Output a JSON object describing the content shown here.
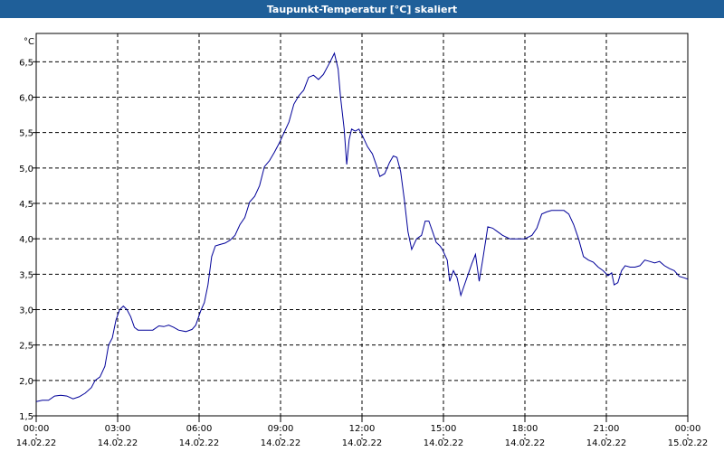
{
  "window": {
    "title": "Taupunkt-Temperatur [°C] skaliert"
  },
  "colors": {
    "title_bar": "#1f5f99",
    "line": "#000099",
    "grid": "#000000"
  },
  "chart_data": {
    "type": "line",
    "title": "Taupunkt-Temperatur [°C] skaliert",
    "unit_label": "°C",
    "ylim": [
      1.5,
      6.9
    ],
    "xlim": [
      0,
      24
    ],
    "grid": true,
    "yticks": [
      "1,5",
      "2,0",
      "2,5",
      "3,0",
      "3,5",
      "4,0",
      "4,5",
      "5,0",
      "5,5",
      "6,0",
      "6,5"
    ],
    "xticks": [
      {
        "time": "00:00",
        "date": "14.02.22"
      },
      {
        "time": "03:00",
        "date": "14.02.22"
      },
      {
        "time": "06:00",
        "date": "14.02.22"
      },
      {
        "time": "09:00",
        "date": "14.02.22"
      },
      {
        "time": "12:00",
        "date": "14.02.22"
      },
      {
        "time": "15:00",
        "date": "14.02.22"
      },
      {
        "time": "18:00",
        "date": "14.02.22"
      },
      {
        "time": "21:00",
        "date": "14.02.22"
      },
      {
        "time": "00:00",
        "date": "15.02.22"
      }
    ],
    "series": [
      {
        "points": [
          [
            0.0,
            1.7
          ],
          [
            0.25,
            1.72
          ],
          [
            0.5,
            1.72
          ],
          [
            0.75,
            1.78
          ],
          [
            1.0,
            1.79
          ],
          [
            1.25,
            1.78
          ],
          [
            1.5,
            1.74
          ],
          [
            1.75,
            1.77
          ],
          [
            2.0,
            1.82
          ],
          [
            2.25,
            1.9
          ],
          [
            2.4,
            2.0
          ],
          [
            2.6,
            2.05
          ],
          [
            2.8,
            2.2
          ],
          [
            2.95,
            2.5
          ],
          [
            3.1,
            2.6
          ],
          [
            3.25,
            2.85
          ],
          [
            3.4,
            3.0
          ],
          [
            3.55,
            3.05
          ],
          [
            3.7,
            3.0
          ],
          [
            3.85,
            2.9
          ],
          [
            4.0,
            2.75
          ],
          [
            4.15,
            2.71
          ],
          [
            4.5,
            2.71
          ],
          [
            4.75,
            2.71
          ],
          [
            5.0,
            2.77
          ],
          [
            5.2,
            2.76
          ],
          [
            5.4,
            2.78
          ],
          [
            5.6,
            2.75
          ],
          [
            5.8,
            2.71
          ],
          [
            6.1,
            2.69
          ],
          [
            6.35,
            2.72
          ],
          [
            6.5,
            2.78
          ],
          [
            6.7,
            2.98
          ],
          [
            6.85,
            3.1
          ],
          [
            7.0,
            3.35
          ],
          [
            7.15,
            3.75
          ],
          [
            7.3,
            3.9
          ],
          [
            7.5,
            3.92
          ],
          [
            7.7,
            3.94
          ],
          [
            7.9,
            3.98
          ],
          [
            8.1,
            4.05
          ],
          [
            8.3,
            4.2
          ],
          [
            8.5,
            4.3
          ],
          [
            8.7,
            4.52
          ],
          [
            8.9,
            4.6
          ],
          [
            9.1,
            4.75
          ],
          [
            9.3,
            5.02
          ],
          [
            9.5,
            5.1
          ],
          [
            9.7,
            5.22
          ],
          [
            9.9,
            5.35
          ],
          [
            10.1,
            5.5
          ],
          [
            10.3,
            5.65
          ],
          [
            10.5,
            5.9
          ],
          [
            10.7,
            6.02
          ],
          [
            10.9,
            6.1
          ],
          [
            11.1,
            6.28
          ],
          [
            11.3,
            6.31
          ],
          [
            11.5,
            6.25
          ],
          [
            11.7,
            6.32
          ],
          [
            11.9,
            6.45
          ],
          [
            12.05,
            6.55
          ],
          [
            12.15,
            6.62
          ],
          [
            12.3,
            6.4
          ],
          [
            12.4,
            6.0
          ],
          [
            12.55,
            5.55
          ],
          [
            12.65,
            5.05
          ],
          [
            12.75,
            5.4
          ],
          [
            12.85,
            5.55
          ],
          [
            13.0,
            5.52
          ],
          [
            13.15,
            5.55
          ],
          [
            13.3,
            5.45
          ],
          [
            13.5,
            5.3
          ],
          [
            13.7,
            5.2
          ],
          [
            13.85,
            5.05
          ],
          [
            14.0,
            4.88
          ],
          [
            14.2,
            4.92
          ],
          [
            14.4,
            5.08
          ],
          [
            14.55,
            5.17
          ],
          [
            14.7,
            5.15
          ],
          [
            14.85,
            4.95
          ],
          [
            15.0,
            4.55
          ],
          [
            15.15,
            4.1
          ],
          [
            15.3,
            3.85
          ],
          [
            15.5,
            4.0
          ],
          [
            15.7,
            4.05
          ],
          [
            15.85,
            4.25
          ],
          [
            16.0,
            4.25
          ],
          [
            16.15,
            4.1
          ],
          [
            16.3,
            3.95
          ],
          [
            16.45,
            3.9
          ],
          [
            16.55,
            3.85
          ],
          [
            16.75,
            3.7
          ],
          [
            16.85,
            3.4
          ],
          [
            17.0,
            3.55
          ],
          [
            17.15,
            3.45
          ],
          [
            17.3,
            3.2
          ],
          [
            17.45,
            3.35
          ],
          [
            17.6,
            3.5
          ],
          [
            17.75,
            3.65
          ],
          [
            17.9,
            3.78
          ],
          [
            18.05,
            3.4
          ],
          [
            18.2,
            3.72
          ],
          [
            18.4,
            4.17
          ],
          [
            18.6,
            4.15
          ],
          [
            18.8,
            4.1
          ],
          [
            19.0,
            4.05
          ],
          [
            19.3,
            4.0
          ],
          [
            19.6,
            4.0
          ],
          [
            19.9,
            4.0
          ],
          [
            20.2,
            4.05
          ],
          [
            20.4,
            4.15
          ],
          [
            20.6,
            4.35
          ],
          [
            20.8,
            4.38
          ],
          [
            21.0,
            4.4
          ],
          [
            21.3,
            4.4
          ],
          [
            21.5,
            4.4
          ],
          [
            21.7,
            4.35
          ],
          [
            21.9,
            4.2
          ],
          [
            22.1,
            4.0
          ],
          [
            22.3,
            3.75
          ],
          [
            22.5,
            3.7
          ],
          [
            22.7,
            3.67
          ],
          [
            22.9,
            3.6
          ],
          [
            23.1,
            3.55
          ],
          [
            23.3,
            3.48
          ],
          [
            23.45,
            3.52
          ],
          [
            23.55,
            3.35
          ],
          [
            23.7,
            3.38
          ],
          [
            23.85,
            3.55
          ],
          [
            24.0,
            3.62
          ],
          [
            24.2,
            3.6
          ],
          [
            24.4,
            3.6
          ],
          [
            24.6,
            3.62
          ],
          [
            24.8,
            3.7
          ],
          [
            25.0,
            3.68
          ],
          [
            25.2,
            3.66
          ],
          [
            25.4,
            3.68
          ],
          [
            25.6,
            3.62
          ],
          [
            25.8,
            3.58
          ],
          [
            26.0,
            3.55
          ],
          [
            26.2,
            3.47
          ],
          [
            26.4,
            3.45
          ],
          [
            26.55,
            3.43
          ]
        ]
      }
    ]
  }
}
